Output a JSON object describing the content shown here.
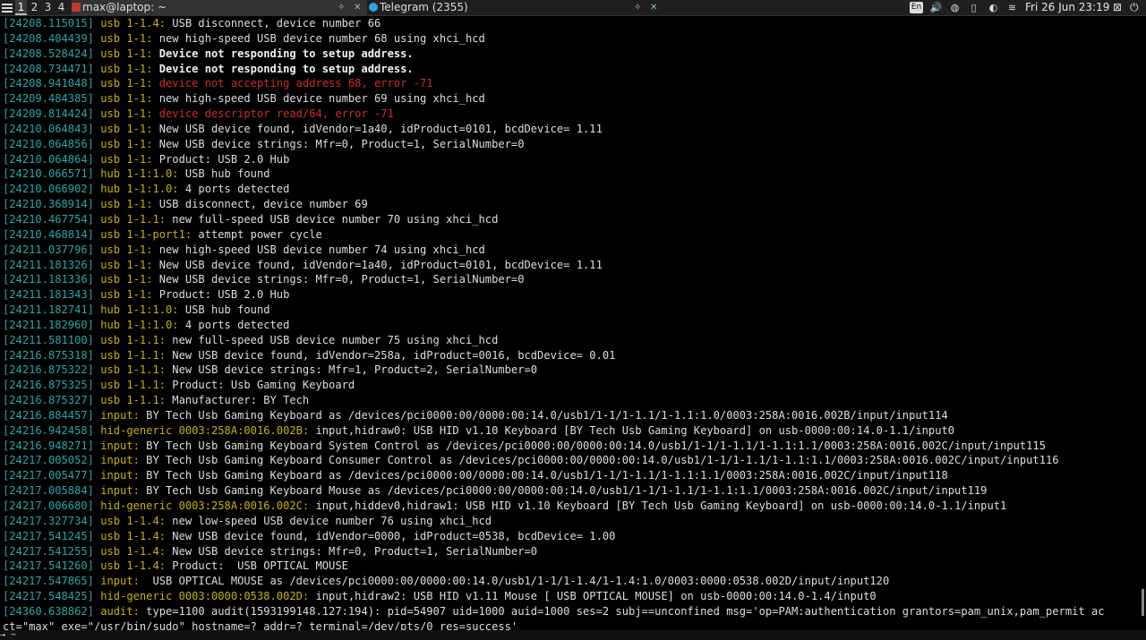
{
  "panel": {
    "workspaces": [
      "1",
      "2",
      "3",
      "4"
    ],
    "tasks": [
      {
        "title": "max@laptop: ~",
        "icon_color": "#c0392b"
      },
      {
        "title": "Telegram (2355)",
        "icon_color": "#2ea6e0"
      }
    ],
    "tray": {
      "keyboard_layout": "En",
      "clock": "Fri 26 Jun 23:19"
    },
    "icons": [
      "menu-icon",
      "terminal-icon",
      "telegram-icon",
      "pin-icon",
      "close-icon",
      "volume-icon",
      "network-icon",
      "battery-icon",
      "brightness-icon",
      "wifi-icon",
      "logout-icon",
      "power-icon"
    ]
  },
  "terminal": {
    "lines": [
      {
        "ts": "[24208.115015]",
        "src": "usb 1-1.4:",
        "msg": " USB disconnect, device number 66",
        "style": "normal"
      },
      {
        "ts": "[24208.404439]",
        "src": "usb 1-1:",
        "msg": " new high-speed USB device number 68 using xhci_hcd",
        "style": "normal"
      },
      {
        "ts": "[24208.528424]",
        "src": "usb 1-1:",
        "msg": " Device not responding to setup address.",
        "style": "bold"
      },
      {
        "ts": "[24208.734471]",
        "src": "usb 1-1:",
        "msg": " Device not responding to setup address.",
        "style": "bold"
      },
      {
        "ts": "[24208.941048]",
        "src": "usb 1-1:",
        "msg": " device not accepting address 68, error -71",
        "style": "err"
      },
      {
        "ts": "[24209.484385]",
        "src": "usb 1-1:",
        "msg": " new high-speed USB device number 69 using xhci_hcd",
        "style": "normal"
      },
      {
        "ts": "[24209.814424]",
        "src": "usb 1-1:",
        "msg": " device descriptor read/64, error -71",
        "style": "err"
      },
      {
        "ts": "[24210.064843]",
        "src": "usb 1-1:",
        "msg": " New USB device found, idVendor=1a40, idProduct=0101, bcdDevice= 1.11",
        "style": "normal"
      },
      {
        "ts": "[24210.064856]",
        "src": "usb 1-1:",
        "msg": " New USB device strings: Mfr=0, Product=1, SerialNumber=0",
        "style": "normal"
      },
      {
        "ts": "[24210.064864]",
        "src": "usb 1-1:",
        "msg": " Product: USB 2.0 Hub",
        "style": "normal"
      },
      {
        "ts": "[24210.066571]",
        "src": "hub 1-1:1.0:",
        "msg": " USB hub found",
        "style": "normal"
      },
      {
        "ts": "[24210.066902]",
        "src": "hub 1-1:1.0:",
        "msg": " 4 ports detected",
        "style": "normal"
      },
      {
        "ts": "[24210.368914]",
        "src": "usb 1-1:",
        "msg": " USB disconnect, device number 69",
        "style": "normal"
      },
      {
        "ts": "[24210.467754]",
        "src": "usb 1-1.1:",
        "msg": " new full-speed USB device number 70 using xhci_hcd",
        "style": "normal"
      },
      {
        "ts": "[24210.468814]",
        "src": "usb 1-1-port1:",
        "msg": " attempt power cycle",
        "style": "normal"
      },
      {
        "ts": "[24211.037796]",
        "src": "usb 1-1:",
        "msg": " new high-speed USB device number 74 using xhci_hcd",
        "style": "normal"
      },
      {
        "ts": "[24211.181326]",
        "src": "usb 1-1:",
        "msg": " New USB device found, idVendor=1a40, idProduct=0101, bcdDevice= 1.11",
        "style": "normal"
      },
      {
        "ts": "[24211.181336]",
        "src": "usb 1-1:",
        "msg": " New USB device strings: Mfr=0, Product=1, SerialNumber=0",
        "style": "normal"
      },
      {
        "ts": "[24211.181343]",
        "src": "usb 1-1:",
        "msg": " Product: USB 2.0 Hub",
        "style": "normal"
      },
      {
        "ts": "[24211.182741]",
        "src": "hub 1-1:1.0:",
        "msg": " USB hub found",
        "style": "normal"
      },
      {
        "ts": "[24211.182960]",
        "src": "hub 1-1:1.0:",
        "msg": " 4 ports detected",
        "style": "normal"
      },
      {
        "ts": "[24211.581100]",
        "src": "usb 1-1.1:",
        "msg": " new full-speed USB device number 75 using xhci_hcd",
        "style": "normal"
      },
      {
        "ts": "[24216.875318]",
        "src": "usb 1-1.1:",
        "msg": " New USB device found, idVendor=258a, idProduct=0016, bcdDevice= 0.01",
        "style": "normal"
      },
      {
        "ts": "[24216.875322]",
        "src": "usb 1-1.1:",
        "msg": " New USB device strings: Mfr=1, Product=2, SerialNumber=0",
        "style": "normal"
      },
      {
        "ts": "[24216.875325]",
        "src": "usb 1-1.1:",
        "msg": " Product: Usb Gaming Keyboard",
        "style": "normal"
      },
      {
        "ts": "[24216.875327]",
        "src": "usb 1-1.1:",
        "msg": " Manufacturer: BY Tech",
        "style": "normal"
      },
      {
        "ts": "[24216.884457]",
        "src": "input:",
        "msg": " BY Tech Usb Gaming Keyboard as /devices/pci0000:00/0000:00:14.0/usb1/1-1/1-1.1/1-1.1:1.0/0003:258A:0016.002B/input/input114",
        "style": "normal"
      },
      {
        "ts": "[24216.942458]",
        "src": "hid-generic 0003:258A:0016.002B:",
        "msg": " input,hidraw0: USB HID v1.10 Keyboard [BY Tech Usb Gaming Keyboard] on usb-0000:00:14.0-1.1/input0",
        "style": "normal"
      },
      {
        "ts": "[24216.948271]",
        "src": "input:",
        "msg": " BY Tech Usb Gaming Keyboard System Control as /devices/pci0000:00/0000:00:14.0/usb1/1-1/1-1.1/1-1.1:1.1/0003:258A:0016.002C/input/input115",
        "style": "normal"
      },
      {
        "ts": "[24217.005052]",
        "src": "input:",
        "msg": " BY Tech Usb Gaming Keyboard Consumer Control as /devices/pci0000:00/0000:00:14.0/usb1/1-1/1-1.1/1-1.1:1.1/0003:258A:0016.002C/input/input116",
        "style": "normal"
      },
      {
        "ts": "[24217.005477]",
        "src": "input:",
        "msg": " BY Tech Usb Gaming Keyboard as /devices/pci0000:00/0000:00:14.0/usb1/1-1/1-1.1/1-1.1:1.1/0003:258A:0016.002C/input/input118",
        "style": "normal"
      },
      {
        "ts": "[24217.005884]",
        "src": "input:",
        "msg": " BY Tech Usb Gaming Keyboard Mouse as /devices/pci0000:00/0000:00:14.0/usb1/1-1/1-1.1/1-1.1:1.1/0003:258A:0016.002C/input/input119",
        "style": "normal"
      },
      {
        "ts": "[24217.006680]",
        "src": "hid-generic 0003:258A:0016.002C:",
        "msg": " input,hiddev0,hidraw1: USB HID v1.10 Keyboard [BY Tech Usb Gaming Keyboard] on usb-0000:00:14.0-1.1/input1",
        "style": "normal"
      },
      {
        "ts": "[24217.327734]",
        "src": "usb 1-1.4:",
        "msg": " new low-speed USB device number 76 using xhci_hcd",
        "style": "normal"
      },
      {
        "ts": "[24217.541245]",
        "src": "usb 1-1.4:",
        "msg": " New USB device found, idVendor=0000, idProduct=0538, bcdDevice= 1.00",
        "style": "normal"
      },
      {
        "ts": "[24217.541255]",
        "src": "usb 1-1.4:",
        "msg": " New USB device strings: Mfr=0, Product=1, SerialNumber=0",
        "style": "normal"
      },
      {
        "ts": "[24217.541260]",
        "src": "usb 1-1.4:",
        "msg": " Product:  USB OPTICAL MOUSE",
        "style": "normal"
      },
      {
        "ts": "[24217.547865]",
        "src": "input:",
        "msg": "  USB OPTICAL MOUSE as /devices/pci0000:00/0000:00:14.0/usb1/1-1/1-1.4/1-1.4:1.0/0003:0000:0538.002D/input/input120",
        "style": "normal"
      },
      {
        "ts": "[24217.548425]",
        "src": "hid-generic 0003:0000:0538.002D:",
        "msg": " input,hidraw2: USB HID v1.11 Mouse [ USB OPTICAL MOUSE] on usb-0000:00:14.0-1.4/input0",
        "style": "normal"
      },
      {
        "ts": "[24360.638862]",
        "src": "audit:",
        "msg": " type=1100 audit(1593199148.127:194): pid=54907 uid=1000 auid=1000 ses=2 subj==unconfined msg='op=PAM:authentication grantors=pam_unix,pam_permit ac",
        "style": "normal"
      },
      {
        "ts": "",
        "src": "",
        "msg": "ct=\"max\" exe=\"/usr/bin/sudo\" hostname=? addr=? terminal=/dev/pts/0 res=success'",
        "style": "normal"
      }
    ],
    "prompt": "~"
  }
}
